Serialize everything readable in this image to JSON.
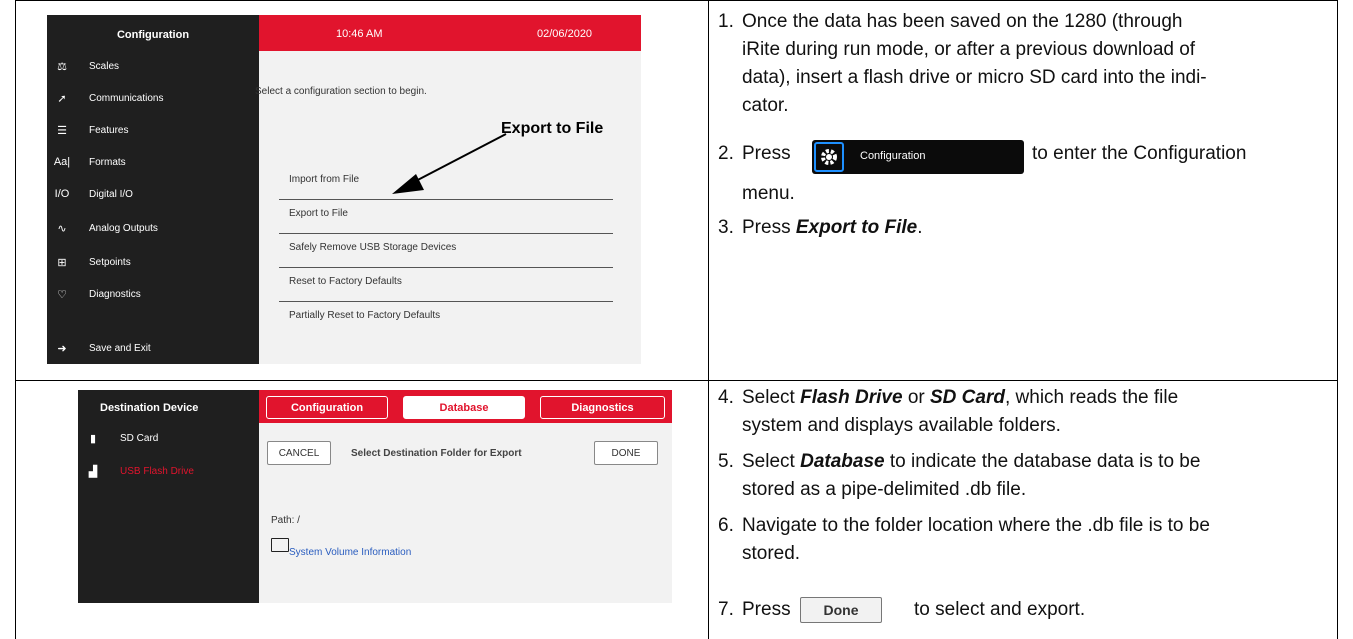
{
  "screen1": {
    "sidebar_title": "Configuration",
    "sidebar_items": [
      {
        "icon": "scales-icon",
        "glyph": "⚖",
        "label": "Scales"
      },
      {
        "icon": "communications-icon",
        "glyph": "➚",
        "label": "Communications"
      },
      {
        "icon": "features-icon",
        "glyph": "☰",
        "label": "Features"
      },
      {
        "icon": "formats-icon",
        "glyph": "Aa|",
        "label": "Formats"
      },
      {
        "icon": "digital-io-icon",
        "glyph": "I/O",
        "label": "Digital I/O"
      },
      {
        "icon": "analog-outputs-icon",
        "glyph": "∿",
        "label": "Analog Outputs"
      },
      {
        "icon": "setpoints-icon",
        "glyph": "⊞",
        "label": "Setpoints"
      },
      {
        "icon": "diagnostics-icon",
        "glyph": "♡",
        "label": "Diagnostics"
      },
      {
        "icon": "save-exit-icon",
        "glyph": "➜",
        "label": "Save and Exit"
      }
    ],
    "time": "10:46 AM",
    "date": "02/06/2020",
    "prompt": "Select a configuration section to begin.",
    "menu": [
      "Import from File",
      "Export to File",
      "Safely Remove USB Storage Devices",
      "Reset to Factory Defaults",
      "Partially Reset to Factory Defaults"
    ],
    "callout": "Export to File"
  },
  "screen2": {
    "sidebar_title": "Destination Device",
    "devices": [
      {
        "label": "SD Card",
        "color": "#ffffff"
      },
      {
        "label": "USB Flash Drive",
        "color": "#e1142d"
      }
    ],
    "tabs": [
      "Configuration",
      "Database",
      "Diagnostics"
    ],
    "cancel": "CANCEL",
    "prompt": "Select Destination Folder for Export",
    "done": "DONE",
    "path": "Path: /",
    "folder": "System Volume Information"
  },
  "steps": {
    "s1": {
      "num": "1.",
      "lines": [
        "Once the data has been saved on the 1280 (through",
        "iRite during run mode, or after a previous download of",
        "data), insert a flash drive or micro SD card into the indi-",
        "cator."
      ]
    },
    "s2_num": "2.",
    "s2_pre": "Press",
    "s2_post": "to enter the Configuration",
    "s2_line2": "menu.",
    "cfg_button": "Configuration",
    "s3_num": "3.",
    "s3_pre": "Press",
    "s3_em": "Export to File",
    "s3_post": ".",
    "s4_num": "4.",
    "s4_a": "Select",
    "s4_em1": "Flash Drive",
    "s4_b": "or",
    "s4_em2": "SD Card",
    "s4_c": ", which reads the file",
    "s4_line2": "system and displays available folders.",
    "s5_num": "5.",
    "s5_a": "Select",
    "s5_em": "Database",
    "s5_b": "to indicate the database data is to be",
    "s5_line2": "stored as a pipe-delimited .db file.",
    "s6_num": "6.",
    "s6_line1": "Navigate to the folder location where the .db file is to be",
    "s6_line2": "stored.",
    "s7_num": "7.",
    "s7_pre": "Press",
    "s7_post": "to select and export.",
    "done_button": "Done"
  }
}
